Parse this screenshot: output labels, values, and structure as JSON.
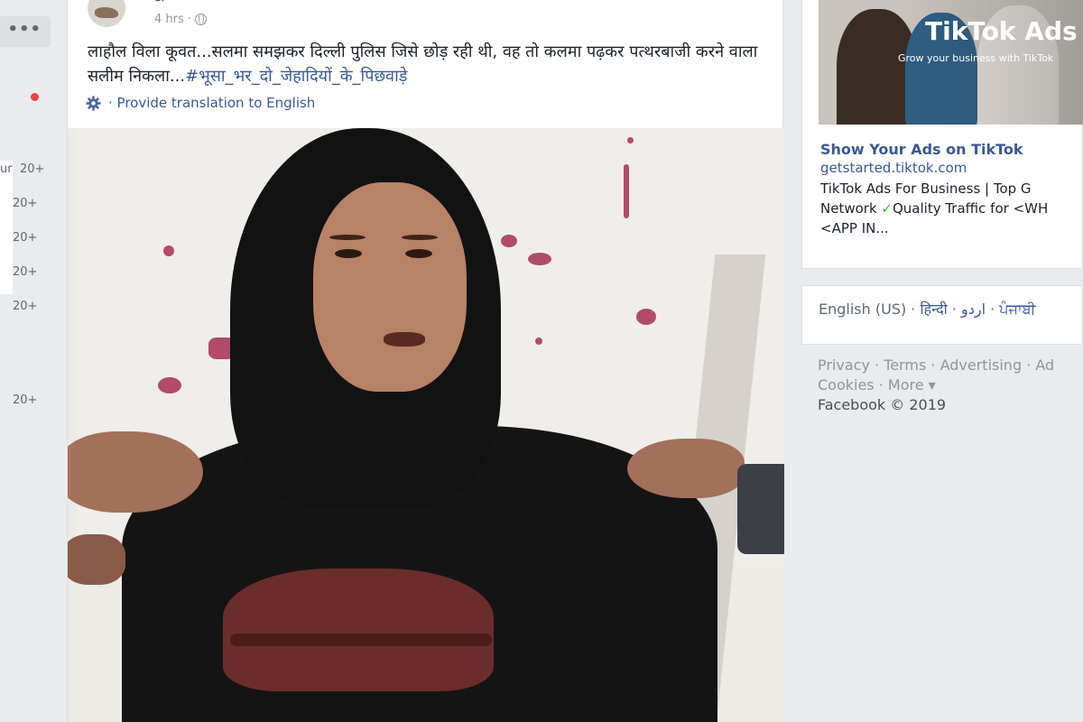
{
  "left_sidebar": {
    "more_label": "•••",
    "counts": [
      "20+",
      "20+",
      "20+",
      "20+",
      "20+",
      "20+"
    ],
    "partial_label": "ur"
  },
  "post": {
    "author": "डॉ ",
    "time": "4 hrs ·",
    "text_main": "लाहौल विला कूवत...सलमा समझकर दिल्ली पुलिस जिसे छोड़ रही थी, वह तो कलमा पढ़कर पत्थरबाजी करने वाला सलीम निकला...",
    "hashtag": "#भूसा_भर_दो_जेहादियों_के_पिछवाड़े",
    "translate_label": "· Provide translation to English"
  },
  "ad": {
    "brand": "TikTok Ads",
    "tagline": "Grow your business with TikTok",
    "title": "Show Your Ads on TikTok",
    "domain": "getstarted.tiktok.com",
    "desc_line1": "TikTok Ads For Business | Top G",
    "desc_line2_a": "Network ",
    "desc_line2_b": "Quality Traffic for <WH",
    "desc_line3": "<APP IN..."
  },
  "languages": {
    "current": "English (US) ·",
    "hindi": "हिन्दी",
    "sep1": " · ",
    "urdu": "اردو",
    "sep2": " · ",
    "punjabi": "ਪੰਜਾਬੀ"
  },
  "footer": {
    "privacy": "Privacy",
    "terms": "Terms",
    "advertising": "Advertising",
    "ad_choices": "Ad",
    "cookies": "Cookies",
    "more": "More ▾",
    "copyright": "Facebook © 2019",
    "sep": " · "
  }
}
